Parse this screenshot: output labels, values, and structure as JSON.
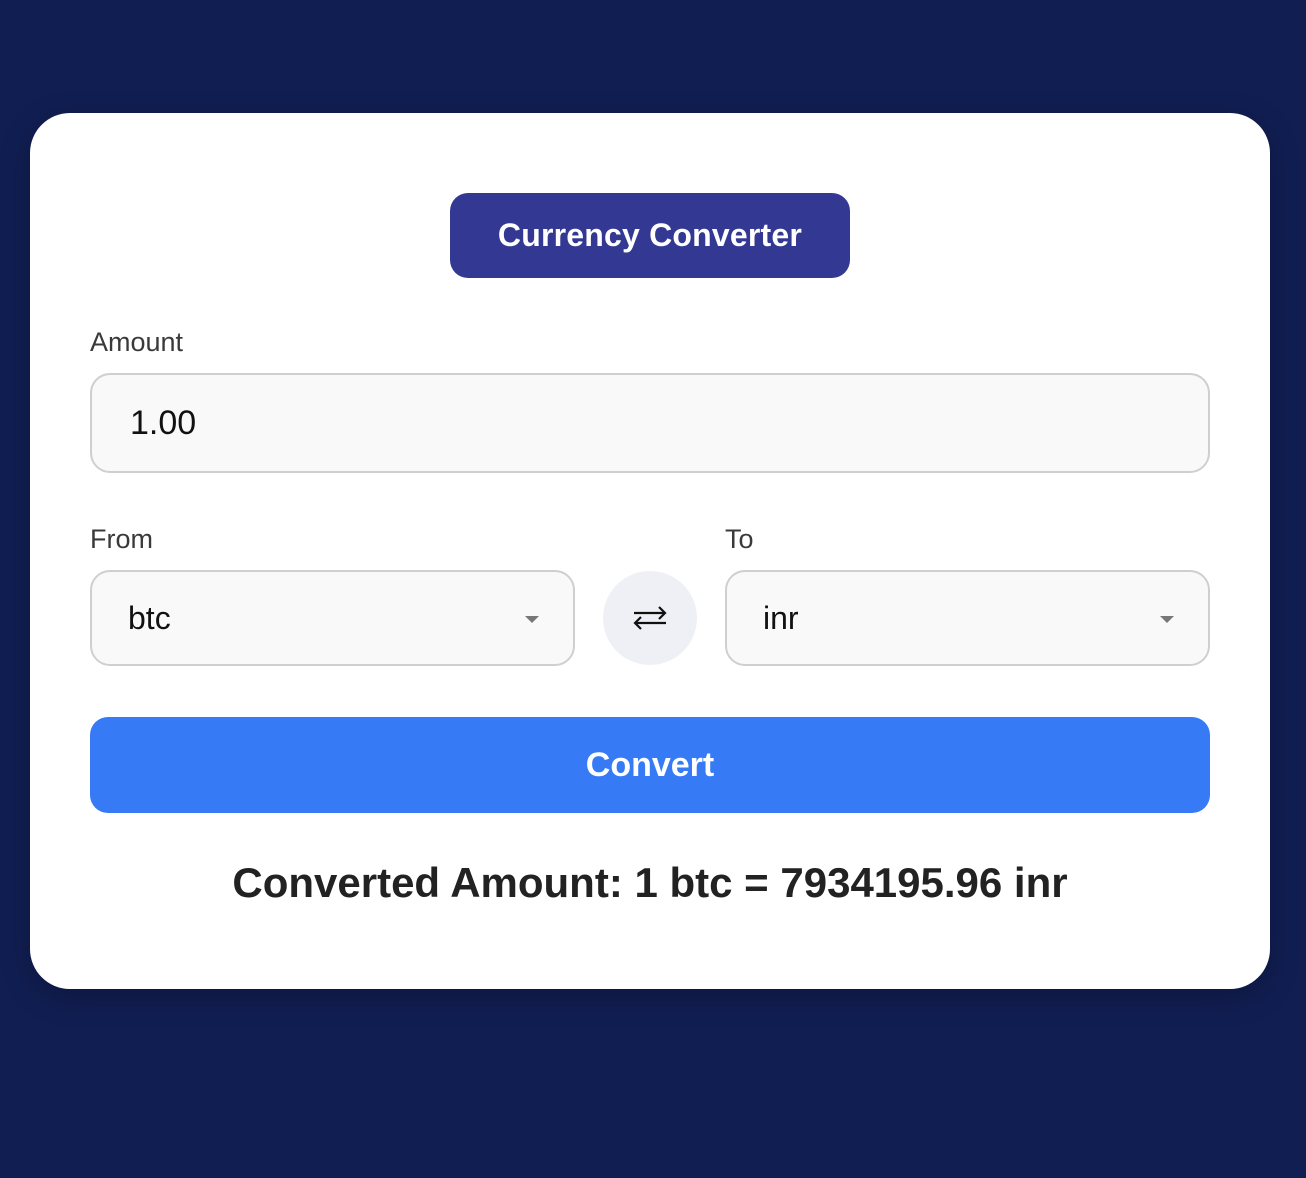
{
  "app": {
    "title": "Currency Converter"
  },
  "amount": {
    "label": "Amount",
    "value": "1.00"
  },
  "from": {
    "label": "From",
    "selected": "btc"
  },
  "to": {
    "label": "To",
    "selected": "inr"
  },
  "swap": {
    "icon": "swap-arrows-icon"
  },
  "convert": {
    "label": "Convert"
  },
  "result": {
    "text": "Converted Amount: 1 btc = 7934195.96 inr"
  },
  "colors": {
    "background": "#111e52",
    "card": "#ffffff",
    "title_badge": "#333993",
    "convert_button": "#367bf5",
    "swap_button": "#eef0f5"
  }
}
